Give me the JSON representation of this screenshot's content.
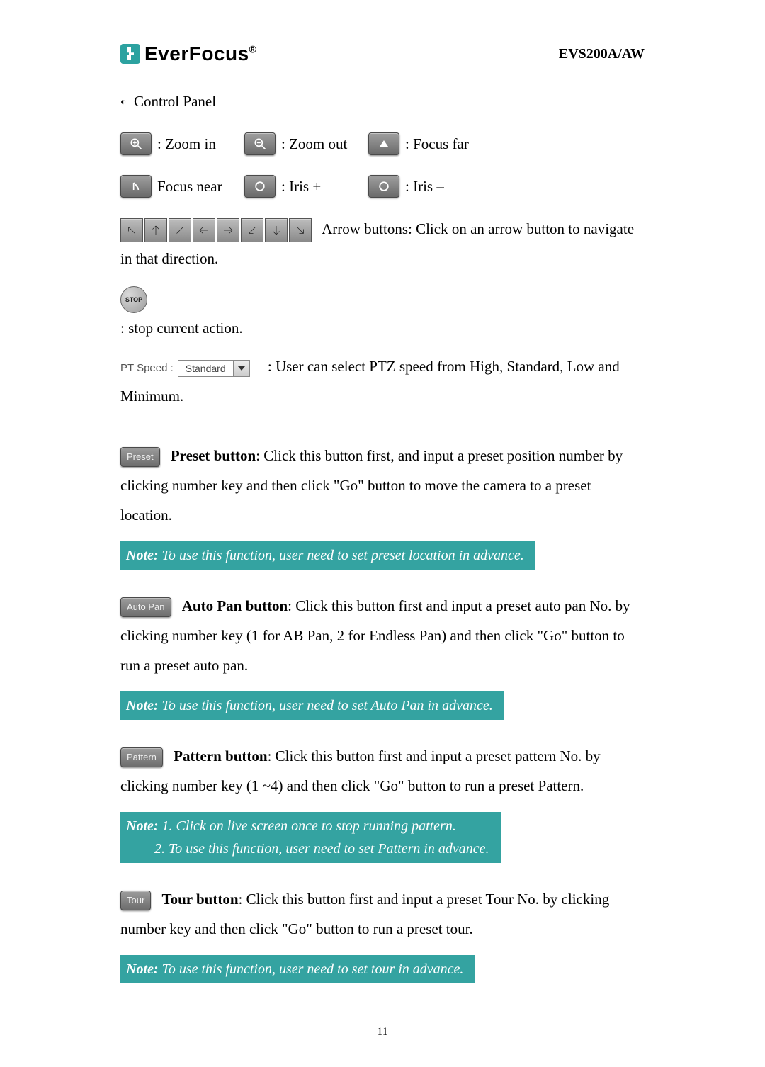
{
  "header": {
    "brand": "EverFocus",
    "model": "EVS200A/AW"
  },
  "section_title": "Control Panel",
  "buttons": {
    "zoom_in": ": Zoom in",
    "zoom_out": ": Zoom out",
    "focus_far": ": Focus far",
    "focus_near": "Focus near",
    "iris_plus": ": Iris +",
    "iris_minus": ": Iris –"
  },
  "arrows_text": "Arrow buttons: Click on an arrow button to navigate in that direction.",
  "stop_icon_label": "STOP",
  "stop_text": ": stop current action.",
  "ptspeed": {
    "label": "PT Speed :",
    "value": "Standard",
    "description": ": User can select PTZ speed from High, Standard, Low and Minimum."
  },
  "preset": {
    "btn": "Preset",
    "title": "Preset button",
    "desc": ": Click this button first, and input a preset position number by clicking number key and then click \"Go\" button to move the camera to a preset location.",
    "note_label": "Note:",
    "note": " To use this function, user need to set preset location in advance."
  },
  "autopan": {
    "btn": "Auto Pan",
    "title": "Auto Pan button",
    "desc": ": Click this button first and input a preset auto pan No. by clicking number key (1 for AB Pan, 2 for Endless Pan) and then click \"Go\" button to run a preset auto pan.",
    "note_label": "Note:",
    "note": " To use this function, user need to set Auto Pan in advance."
  },
  "pattern": {
    "btn": "Pattern",
    "title": "Pattern button",
    "desc": ": Click this button first and input a preset pattern No. by clicking number key (1 ~4) and then click \"Go\" button to run a preset Pattern.",
    "note_label": "Note:",
    "note_line1": " 1. Click on live screen once to stop running pattern.",
    "note_line2": "2. To use this function, user need to set Pattern in advance."
  },
  "tour": {
    "btn": "Tour",
    "title": "Tour button",
    "desc": ": Click this button first and input a preset Tour No. by clicking number key and then click \"Go\" button to run a preset tour.",
    "note_label": "Note:",
    "note": " To use this function, user need to set tour in advance."
  },
  "page_number": "11"
}
